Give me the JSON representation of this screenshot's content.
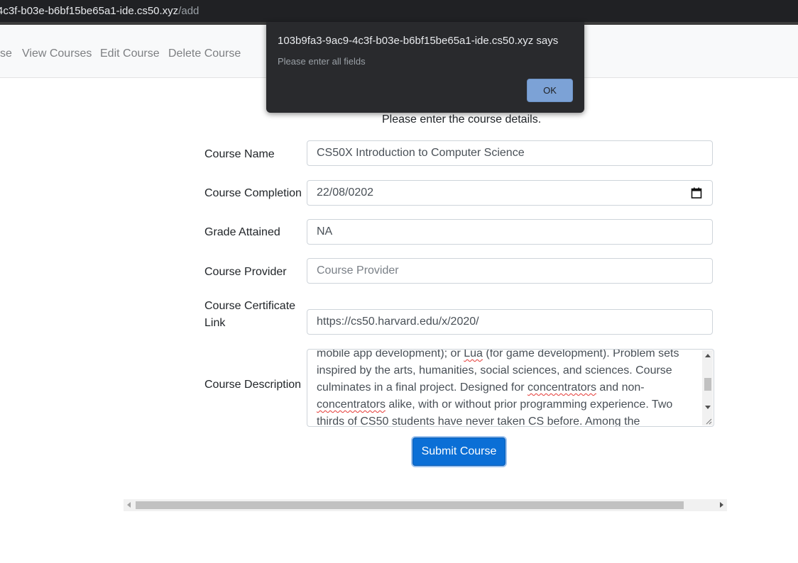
{
  "browser": {
    "url_host": "4c3f-b03e-b6bf15be65a1-ide.cs50.xyz",
    "url_path": "/add"
  },
  "nav": {
    "items": [
      {
        "label": "se"
      },
      {
        "label": "View Courses"
      },
      {
        "label": "Edit Course"
      },
      {
        "label": "Delete Course"
      }
    ]
  },
  "form": {
    "intro": "Please enter the course details.",
    "course_name": {
      "label": "Course Name",
      "value": "CS50X Introduction to Computer Science"
    },
    "course_completion": {
      "label": "Course Completion",
      "value": "22/08/0202"
    },
    "grade": {
      "label": "Grade Attained",
      "value": "NA"
    },
    "provider": {
      "label": "Course Provider",
      "placeholder": "Course Provider"
    },
    "certificate": {
      "label_line1": "Course Certificate",
      "label_line2": "Link",
      "value": "https://cs50.harvard.edu/x/2020/"
    },
    "description": {
      "label": "Course Description",
      "line1_a": "mobile app development); or ",
      "line1_b": "Lua",
      "line1_c": " (for game development). Problem sets",
      "line2": "inspired by the arts, humanities, social sciences, and sciences. Course",
      "line3_a": "culminates in a final project. Designed for ",
      "line3_b": "concentrators",
      "line3_c": " and non-",
      "line4_a": "concentrators",
      "line4_b": " alike, with or without prior programming experience. Two",
      "line5": "thirds of CS50 students have never taken CS before. Among the"
    },
    "submit_label": "Submit Course"
  },
  "dialog": {
    "title": "103b9fa3-9ac9-4c3f-b03e-b6bf15be65a1-ide.cs50.xyz says",
    "message": "Please enter all fields",
    "ok_label": "OK"
  }
}
